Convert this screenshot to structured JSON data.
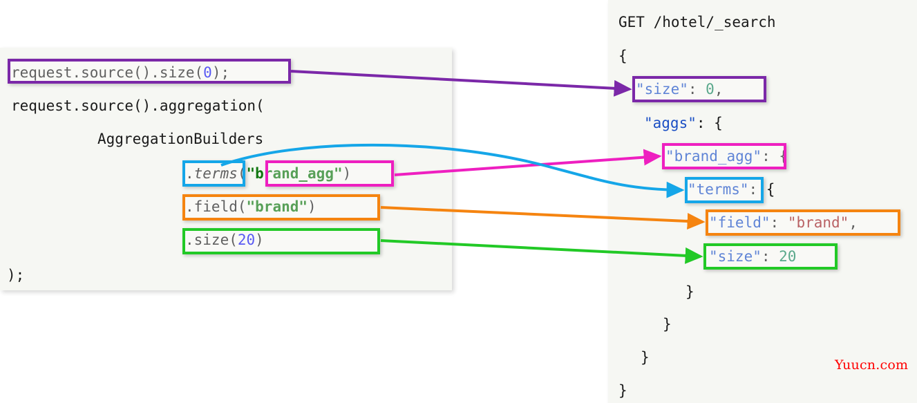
{
  "colors": {
    "purple": "#7b28a8",
    "magenta": "#ee1fc0",
    "cyan": "#15a6e8",
    "orange": "#f58410",
    "green": "#22c926",
    "panel_bg": "#f6f7f3",
    "page_bg": "#ffffff",
    "json_key": "#1b4fc4",
    "json_number": "#13835a",
    "json_string": "#9b1d22",
    "java_string": "#117711",
    "java_number": "#1010ee",
    "watermark": "#ff0000"
  },
  "left_panel": {
    "name": "java-code-panel",
    "lines": [
      {
        "id": "l1",
        "text": "request.source().size(0);",
        "parts": [
          {
            "t": "request.source().size(",
            "cls": ""
          },
          {
            "t": "0",
            "cls": "tok-num"
          },
          {
            "t": ");",
            "cls": ""
          }
        ]
      },
      {
        "id": "l2",
        "text": "request.source().aggregation(",
        "parts": [
          {
            "t": "request.source().aggregation(",
            "cls": ""
          }
        ]
      },
      {
        "id": "l3",
        "text": "AggregationBuilders",
        "parts": [
          {
            "t": "AggregationBuilders",
            "cls": ""
          }
        ]
      },
      {
        "id": "l4",
        "text": ".terms(\"brand_agg\")",
        "parts": [
          {
            "t": ".",
            "cls": ""
          },
          {
            "t": "terms",
            "cls": "tok-em"
          },
          {
            "t": "(",
            "cls": ""
          },
          {
            "t": "\"brand_agg\"",
            "cls": "tok-str-j"
          },
          {
            "t": ")",
            "cls": ""
          }
        ]
      },
      {
        "id": "l5",
        "text": ".field(\"brand\")",
        "parts": [
          {
            "t": ".field(",
            "cls": ""
          },
          {
            "t": "\"brand\"",
            "cls": "tok-str-j"
          },
          {
            "t": ")",
            "cls": ""
          }
        ]
      },
      {
        "id": "l6",
        "text": ".size(20)",
        "parts": [
          {
            "t": ".size(",
            "cls": ""
          },
          {
            "t": "20",
            "cls": "tok-num"
          },
          {
            "t": ")",
            "cls": ""
          }
        ]
      },
      {
        "id": "l7",
        "text": ");",
        "parts": [
          {
            "t": ");",
            "cls": ""
          }
        ]
      }
    ]
  },
  "right_panel": {
    "name": "json-dsl-panel",
    "lines": [
      {
        "id": "r1",
        "text": "GET /hotel/_search",
        "parts": [
          {
            "t": "GET /hotel/_search",
            "cls": ""
          }
        ]
      },
      {
        "id": "r2",
        "text": "{",
        "parts": [
          {
            "t": "{",
            "cls": ""
          }
        ]
      },
      {
        "id": "r3",
        "text": "\"size\": 0,",
        "parts": [
          {
            "t": "\"size\"",
            "cls": "j-key"
          },
          {
            "t": ": ",
            "cls": ""
          },
          {
            "t": "0",
            "cls": "j-num"
          },
          {
            "t": ",",
            "cls": ""
          }
        ]
      },
      {
        "id": "r4",
        "text": "\"aggs\": {",
        "parts": [
          {
            "t": "\"aggs\"",
            "cls": "j-key"
          },
          {
            "t": ": {",
            "cls": ""
          }
        ]
      },
      {
        "id": "r5",
        "text": "\"brand_agg\": {",
        "parts": [
          {
            "t": "\"brand_agg\"",
            "cls": "j-key"
          },
          {
            "t": ": {",
            "cls": ""
          }
        ]
      },
      {
        "id": "r6",
        "text": "\"terms\": {",
        "parts": [
          {
            "t": "\"terms\"",
            "cls": "j-key"
          },
          {
            "t": ": {",
            "cls": ""
          }
        ]
      },
      {
        "id": "r7",
        "text": "\"field\": \"brand\",",
        "parts": [
          {
            "t": "\"field\"",
            "cls": "j-key"
          },
          {
            "t": ": ",
            "cls": ""
          },
          {
            "t": "\"brand\"",
            "cls": "j-str"
          },
          {
            "t": ",",
            "cls": ""
          }
        ]
      },
      {
        "id": "r8",
        "text": "\"size\": 20",
        "parts": [
          {
            "t": "\"size\"",
            "cls": "j-key"
          },
          {
            "t": ": ",
            "cls": ""
          },
          {
            "t": "20",
            "cls": "j-num"
          }
        ]
      },
      {
        "id": "r9",
        "text": "}",
        "parts": [
          {
            "t": "}",
            "cls": ""
          }
        ]
      },
      {
        "id": "r10",
        "text": "}",
        "parts": [
          {
            "t": "}",
            "cls": ""
          }
        ]
      },
      {
        "id": "r11",
        "text": "}",
        "parts": [
          {
            "t": "}",
            "cls": ""
          }
        ]
      },
      {
        "id": "r12",
        "text": "}",
        "parts": [
          {
            "t": "}",
            "cls": ""
          }
        ]
      }
    ]
  },
  "mappings": [
    {
      "id": "m-size0",
      "color": "#7b28a8",
      "java": "request.source().size(0);",
      "json": "\"size\": 0,"
    },
    {
      "id": "m-brand-agg",
      "color": "#ee1fc0",
      "java": "\"brand_agg\"",
      "json": "\"brand_agg\""
    },
    {
      "id": "m-terms",
      "color": "#15a6e8",
      "java": ".terms",
      "json": "\"terms\""
    },
    {
      "id": "m-field",
      "color": "#f58410",
      "java": ".field(\"brand\")",
      "json": "\"field\": \"brand\","
    },
    {
      "id": "m-size20",
      "color": "#22c926",
      "java": ".size(20)",
      "json": "\"size\": 20"
    }
  ],
  "watermark": {
    "text": "Yuucn.com"
  }
}
